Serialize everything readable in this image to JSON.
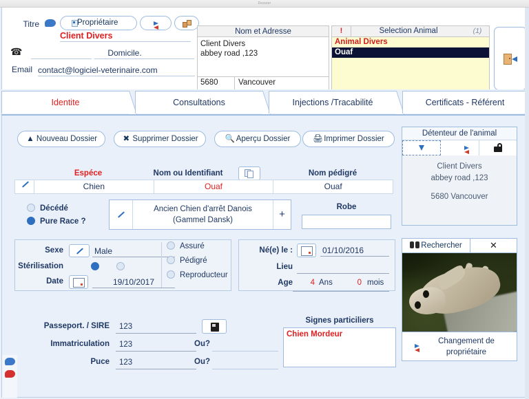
{
  "window": {
    "title": "Dossier"
  },
  "client": {
    "titre_label": "Titre",
    "speech_icon": "speech-bubble-icon",
    "proprietaire_button": "Propriétaire",
    "transfer_button_icon": "people-transfer-icon",
    "box_button_icon": "boxes-icon",
    "name": "Client Divers",
    "phone_icon": "☎",
    "phone_value": "",
    "domicile_label": "Domicile.",
    "domicile_value": "",
    "email_label": "Email",
    "email_value": "contact@logiciel-veterinaire.com"
  },
  "address": {
    "header": "Nom et Adresse",
    "line1": "Client Divers",
    "line2": "abbey road ,123",
    "zip": "5680",
    "city": "Vancouver"
  },
  "animal_selection": {
    "warning": "!",
    "header": "Selection Animal",
    "count": "(1)",
    "rows": [
      {
        "label": "Animal Divers",
        "selected": false
      },
      {
        "label": "Ouaf",
        "selected": true
      }
    ]
  },
  "exit_button": {
    "icon": "door-exit-icon"
  },
  "tabs": [
    {
      "label": "Identite",
      "active": true
    },
    {
      "label": "Consultations",
      "active": false
    },
    {
      "label": "Injections /Tracabilité",
      "active": false
    },
    {
      "label": "Certificats - Référent",
      "active": false
    }
  ],
  "actions": [
    {
      "label": "Nouveau Dossier",
      "icon": "new-file-icon"
    },
    {
      "label": "Supprimer Dossier",
      "icon": "delete-x-icon"
    },
    {
      "label": "Aperçu Dossier",
      "icon": "preview-magnifier-icon"
    },
    {
      "label": "Imprimer Dossier",
      "icon": "printer-icon"
    }
  ],
  "species_row": {
    "espece_label": "Espéce",
    "nom_identifiant_label": "Nom ou Identifiant",
    "copy_button_icon": "copy-icon",
    "nom_pedigre_label": "Nom pédigré",
    "edit_icon": "pencil-icon",
    "espece_value": "Chien",
    "nom_value": "Ouaf",
    "pedigre_value": "Ouaf"
  },
  "status_radios": [
    {
      "label": "Décédé",
      "checked": false
    },
    {
      "label": "Pure Race ?",
      "checked": true
    }
  ],
  "breed": {
    "edit_icon": "pencil-icon",
    "value": "Ancien Chien d'arrêt Danois (Gammel Dansk)",
    "add_button": "+"
  },
  "robe": {
    "label": "Robe",
    "value": ""
  },
  "detenteur": {
    "title": "Détenteur de l'animal",
    "buttons": [
      {
        "icon": "down-arrow-icon"
      },
      {
        "icon": "people-transfer-icon"
      },
      {
        "icon": "lock-icon"
      }
    ],
    "line1": "Client Divers",
    "line2": "abbey road ,123",
    "line3": "5680 Vancouver"
  },
  "sex_panel": {
    "sexe_label": "Sexe",
    "sexe_edit_icon": "pencil-icon",
    "sexe_value": "Male",
    "sterilisation_label": "Stérilisation",
    "sterilisation_yes": true,
    "date_label": "Date",
    "date_icon": "calendar-icon",
    "date_value": "19/10/2017"
  },
  "insurance_radios": [
    {
      "label": "Assuré",
      "checked": false
    },
    {
      "label": "Pédigré",
      "checked": false
    },
    {
      "label": "Reproducteur",
      "checked": false
    }
  ],
  "birth_panel": {
    "ne_label": "Né(e) le :",
    "ne_icon": "calendar-icon",
    "ne_value": "01/10/2016",
    "lieu_label": "Lieu",
    "lieu_value": "",
    "age_label": "Age",
    "age_years": "4",
    "age_years_unit": "Ans",
    "age_months": "0",
    "age_months_unit": "mois"
  },
  "photo_panel": {
    "search_button": "Rechercher",
    "search_icon": "binoculars-icon",
    "close_button": "✕",
    "photo_alt": "dog-photo",
    "change_owner_label": "Changement de propriétaire",
    "change_owner_icon": "people-transfer-icon"
  },
  "identification": {
    "passeport_label": "Passeport. / SIRE",
    "passeport_value": "123",
    "card_button_icon": "id-card-icon",
    "immatriculation_label": "Immatriculation",
    "immatriculation_value": "123",
    "immatriculation_ou_label": "Ou?",
    "immatriculation_ou_value": "",
    "puce_label": "Puce",
    "puce_value": "123",
    "puce_ou_label": "Ou?",
    "puce_ou_value": ""
  },
  "signes": {
    "label": "Signes particiliers",
    "value": "Chien Mordeur"
  },
  "left_strip": [
    {
      "icon": "blue-speech-bubble-icon"
    },
    {
      "icon": "red-speech-bubble-icon"
    },
    {
      "icon": "pie-chart-icon"
    }
  ],
  "colors": {
    "accent_red": "#e02020",
    "navy": "#1f3864",
    "panel_blue": "#eaf0f9",
    "selection_yellow": "#fdfbd0",
    "selected_row": "#0b1236"
  }
}
